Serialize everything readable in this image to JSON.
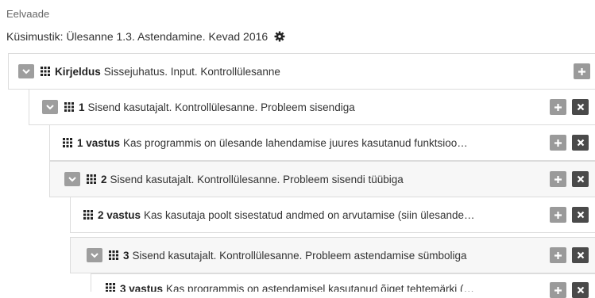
{
  "header": {
    "preview_label": "Eelvaade",
    "survey_label": "Küsimustik: Ülesanne 1.3. Astendamine. Kevad 2016"
  },
  "tree": {
    "root": {
      "keyword": "Kirjeldus",
      "text": "Sissejuhatus. Input. Kontrollülesanne"
    },
    "q1": {
      "number": "1",
      "text": "Sisend kasutajalt. Kontrollülesanne. Probleem sisendiga"
    },
    "a1": {
      "keyword": "1 vastus",
      "text": "Kas programmis on ülesande lahendamise juures kasutanud funktsioo…"
    },
    "q2": {
      "number": "2",
      "text": "Sisend kasutajalt. Kontrollülesanne. Probleem sisendi tüübiga"
    },
    "a2": {
      "keyword": "2 vastus",
      "text": "Kas kasutaja poolt sisestatud andmed on arvutamise (siin ülesande…"
    },
    "q3": {
      "number": "3",
      "text": "Sisend kasutajalt. Kontrollülesanne. Probleem astendamise sümboliga"
    },
    "a3": {
      "keyword": "3 vastus",
      "text": "Kas programmis on astendamisel kasutanud õiget tehtemärki (…"
    }
  },
  "colors": {
    "toggle": "#9e9e9e",
    "add_button": "#9a9a9a",
    "delete_button": "#4a4a4a",
    "row_border": "#dcdcdc"
  },
  "icons": {
    "collapse": "chevron-down-icon",
    "drag": "grid-icon",
    "add": "plus-icon",
    "delete": "close-icon",
    "settings": "gear-icon"
  }
}
